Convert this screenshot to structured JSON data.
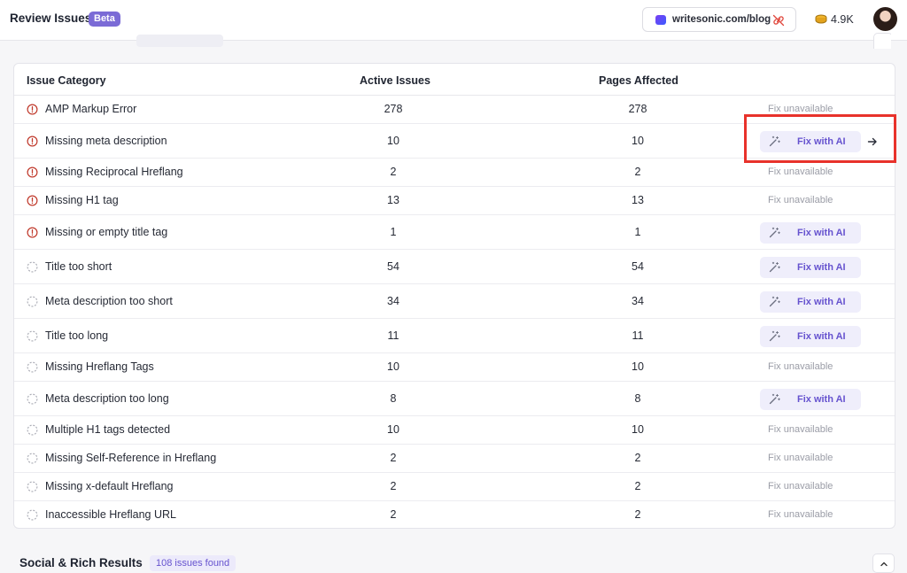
{
  "header": {
    "title": "Review Issues",
    "badge": "Beta",
    "site": "writesonic.com/blog",
    "credits": "4.9K"
  },
  "table": {
    "headers": [
      "Issue Category",
      "Active Issues",
      "Pages Affected"
    ],
    "fix_label": "Fix with AI",
    "unavailable_label": "Fix unavailable",
    "rows": [
      {
        "name": "AMP Markup Error",
        "severity": "error",
        "active": "278",
        "pages": "278",
        "fix": false
      },
      {
        "name": "Missing meta description",
        "severity": "error",
        "active": "10",
        "pages": "10",
        "fix": true,
        "arrow": true
      },
      {
        "name": "Missing Reciprocal Hreflang",
        "severity": "error",
        "active": "2",
        "pages": "2",
        "fix": false
      },
      {
        "name": "Missing H1 tag",
        "severity": "error",
        "active": "13",
        "pages": "13",
        "fix": false
      },
      {
        "name": "Missing or empty title tag",
        "severity": "error",
        "active": "1",
        "pages": "1",
        "fix": true
      },
      {
        "name": "Title too short",
        "severity": "warning",
        "active": "54",
        "pages": "54",
        "fix": true
      },
      {
        "name": "Meta description too short",
        "severity": "warning",
        "active": "34",
        "pages": "34",
        "fix": true
      },
      {
        "name": "Title too long",
        "severity": "warning",
        "active": "11",
        "pages": "11",
        "fix": true
      },
      {
        "name": "Missing Hreflang Tags",
        "severity": "warning",
        "active": "10",
        "pages": "10",
        "fix": false
      },
      {
        "name": "Meta description too long",
        "severity": "warning",
        "active": "8",
        "pages": "8",
        "fix": true
      },
      {
        "name": "Multiple H1 tags detected",
        "severity": "warning",
        "active": "10",
        "pages": "10",
        "fix": false
      },
      {
        "name": "Missing Self-Reference in Hreflang",
        "severity": "warning",
        "active": "2",
        "pages": "2",
        "fix": false
      },
      {
        "name": "Missing x-default Hreflang",
        "severity": "warning",
        "active": "2",
        "pages": "2",
        "fix": false
      },
      {
        "name": "Inaccessible Hreflang URL",
        "severity": "warning",
        "active": "2",
        "pages": "2",
        "fix": false
      }
    ]
  },
  "footer_section": {
    "title": "Social & Rich Results",
    "badge": "108 issues found"
  },
  "colors": {
    "accent": "#7b6bd6",
    "error": "#c0392b",
    "highlight": "#e8322b"
  }
}
